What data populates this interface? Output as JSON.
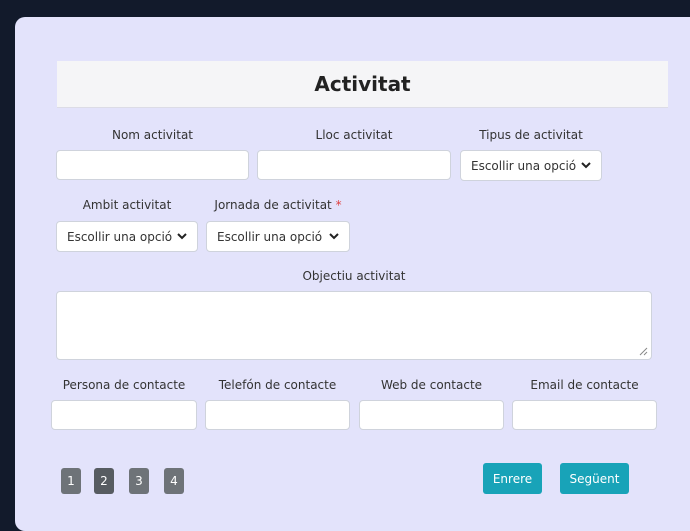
{
  "form": {
    "title": "Activitat",
    "fields": {
      "nom_activitat": {
        "label": "Nom activitat",
        "value": ""
      },
      "lloc_activitat": {
        "label": "Lloc activitat",
        "value": ""
      },
      "tipus_activitat": {
        "label": "Tipus de activitat",
        "selected": "Escollir una opció"
      },
      "ambit_activitat": {
        "label": "Ambit activitat",
        "selected": "Escollir una opció"
      },
      "jornada_activitat": {
        "label": "Jornada de activitat",
        "required_mark": "*",
        "selected": "Escollir una opció"
      },
      "objectiu_activitat": {
        "label": "Objectiu activitat",
        "value": ""
      },
      "persona_contacte": {
        "label": "Persona de contacte",
        "value": ""
      },
      "telefon_contacte": {
        "label": "Telefón de contacte",
        "value": ""
      },
      "web_contacte": {
        "label": "Web de contacte",
        "value": ""
      },
      "email_contacte": {
        "label": "Email de contacte",
        "value": ""
      }
    }
  },
  "pagination": {
    "pages": [
      "1",
      "2",
      "3",
      "4"
    ],
    "current": "2"
  },
  "navigation": {
    "back_label": "Enrere",
    "next_label": "Següent"
  },
  "colors": {
    "card_background": "#e3e3fb",
    "accent": "#18a3b8",
    "page_button": "#6e7378"
  }
}
